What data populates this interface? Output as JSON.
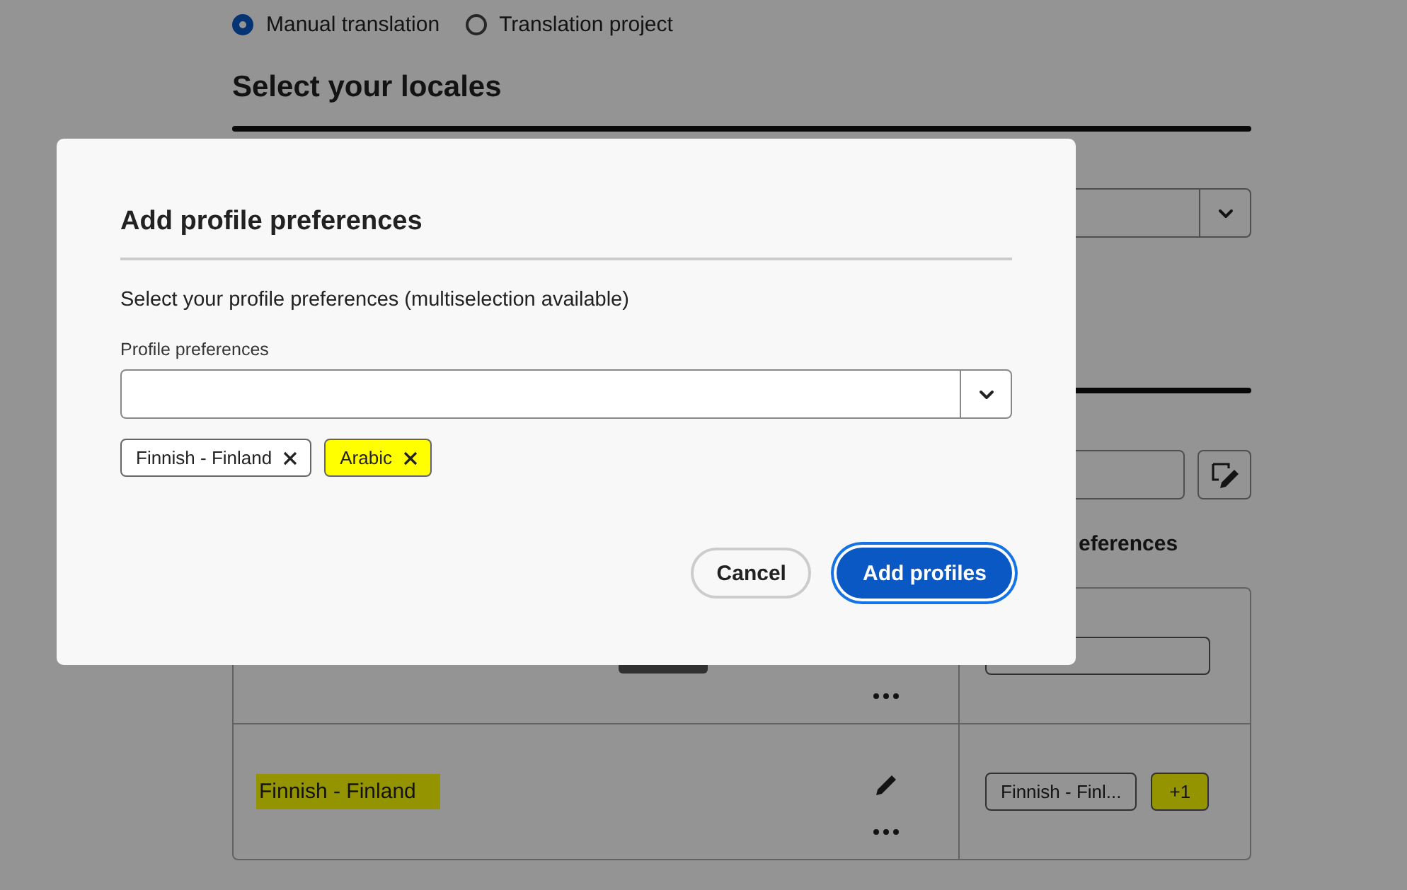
{
  "mode_options": [
    {
      "label": "Manual translation",
      "selected": true
    },
    {
      "label": "Translation project",
      "selected": false
    }
  ],
  "section_title": "Select your locales",
  "preferences_header": "eferences",
  "locales": [
    {
      "has_badge": true,
      "profiles": [
        {
          "highlighted": false
        }
      ]
    },
    {
      "name": "Finnish - Finland",
      "highlighted": true,
      "editable": true,
      "profiles": [
        {
          "label": "Finnish - Finl...",
          "highlighted": false
        },
        {
          "label": "+1",
          "highlighted": true
        }
      ]
    }
  ],
  "dialog": {
    "title": "Add profile preferences",
    "description": "Select your profile preferences (multiselection available)",
    "field_label": "Profile preferences",
    "chips": [
      {
        "label": "Finnish - Finland",
        "highlighted": false
      },
      {
        "label": "Arabic",
        "highlighted": true
      }
    ],
    "buttons": [
      {
        "label": "Cancel",
        "kind": "secondary",
        "focused": false
      },
      {
        "label": "Add profiles",
        "kind": "primary",
        "focused": true
      }
    ]
  }
}
